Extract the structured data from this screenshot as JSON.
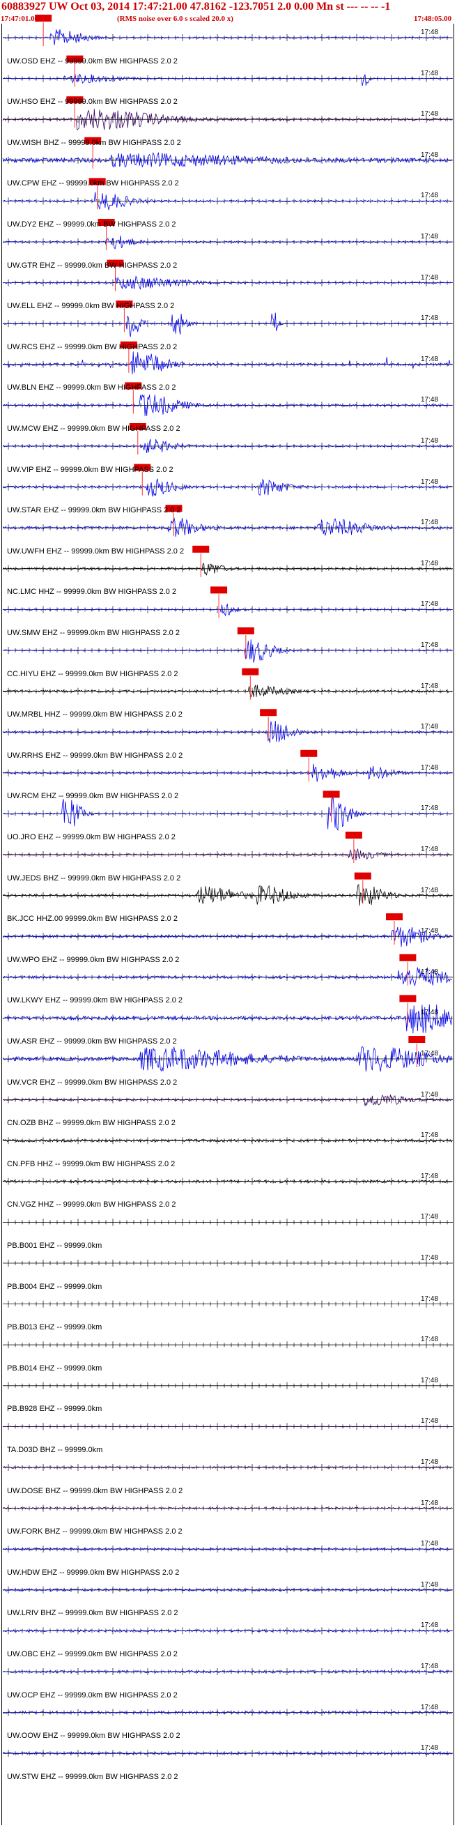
{
  "header": {
    "title": "60883927 UW Oct 03, 2014 17:47:21.00   47.8162 -123.7051  2.0 0.00 Mn st --- -- --   -1",
    "start_time": "17:47:01.00",
    "rms_note": "(RMS noise over 6.0 s scaled 20.0 x)",
    "end_time": "17:48:05.00"
  },
  "time_tick_label": "17:48",
  "colors": {
    "header_text": "#cc0000",
    "pick": "#e00000",
    "pick_line": "#ff3030",
    "trace_blue": "#0000ee",
    "trace_black": "#000000",
    "trace_purple": "#33005a",
    "axis": "#000000"
  },
  "traces": [
    {
      "label": "UW.OSD EHZ -- 99999.0km BW  HIGHPASS  2.0  2",
      "color": "blue",
      "amp": 0.35,
      "pick": 0.09,
      "bursts": [
        [
          0.12,
          0.05,
          2.2
        ]
      ]
    },
    {
      "label": "UW.HSO EHZ -- 99999.0km BW  HIGHPASS  2.0  2",
      "color": "blue",
      "amp": 0.25,
      "pick": 0.16,
      "bursts": [
        [
          0.16,
          0.08,
          1.2
        ],
        [
          0.8,
          0.01,
          2.5
        ]
      ]
    },
    {
      "label": "UW.WISH BHZ -- 99999.0km BW  HIGHPASS  2.0  2",
      "color": "purple",
      "amp": 0.5,
      "pick": 0.16,
      "bursts": [
        [
          0.2,
          0.12,
          3.0
        ]
      ]
    },
    {
      "label": "UW.CPW EHZ -- 99999.0km BW  HIGHPASS  2.0  2",
      "color": "blue",
      "amp": 1.0,
      "pick": 0.2,
      "bursts": [
        [
          0.3,
          0.2,
          1.5
        ]
      ]
    },
    {
      "label": "UW.DY2 EHZ -- 99999.0km BW  HIGHPASS  2.0  2",
      "color": "blue",
      "amp": 0.35,
      "pick": 0.21,
      "bursts": [
        [
          0.22,
          0.05,
          2.5
        ]
      ]
    },
    {
      "label": "UW.GTR EHZ -- 99999.0km BW  HIGHPASS  2.0  2",
      "color": "blue",
      "amp": 0.3,
      "pick": 0.23,
      "bursts": [
        [
          0.24,
          0.04,
          2.0
        ]
      ]
    },
    {
      "label": "UW.ELL EHZ -- 99999.0km BW  HIGHPASS  2.0  2",
      "color": "blue",
      "amp": 0.3,
      "pick": 0.25,
      "bursts": [
        [
          0.28,
          0.1,
          1.8
        ]
      ]
    },
    {
      "label": "UW.RCS EHZ -- 99999.0km BW  HIGHPASS  2.0  2",
      "color": "blue",
      "amp": 0.3,
      "pick": 0.27,
      "bursts": [
        [
          0.28,
          0.02,
          5.0
        ],
        [
          0.38,
          0.02,
          4.5
        ],
        [
          0.6,
          0.01,
          4.0
        ]
      ]
    },
    {
      "label": "UW.BLN EHZ -- 99999.0km BW  HIGHPASS  2.0  2",
      "color": "blue",
      "amp": 0.5,
      "pick": 0.28,
      "bursts": [
        [
          0.3,
          0.05,
          3.5
        ]
      ],
      "spikes": true
    },
    {
      "label": "UW.MCW EHZ -- 99999.0km BW  HIGHPASS  2.0  2",
      "color": "blue",
      "amp": 0.45,
      "pick": 0.29,
      "bursts": [
        [
          0.32,
          0.06,
          3.0
        ]
      ]
    },
    {
      "label": "UW.VIP EHZ -- 99999.0km BW  HIGHPASS  2.0  2",
      "color": "blue",
      "amp": 0.3,
      "pick": 0.3,
      "bursts": [
        [
          0.32,
          0.05,
          2.0
        ]
      ]
    },
    {
      "label": "UW.STAR EHZ -- 99999.0km BW  HIGHPASS  2.0  2",
      "color": "blue",
      "amp": 0.45,
      "pick": 0.31,
      "bursts": [
        [
          0.33,
          0.04,
          2.5
        ],
        [
          0.58,
          0.04,
          2.2
        ]
      ]
    },
    {
      "label": "UW.UWFH EHZ -- 99999.0km BW  HIGHPASS  2.0  2",
      "color": "blue",
      "amp": 0.6,
      "pick": 0.38,
      "bursts": [
        [
          0.38,
          0.04,
          2.8
        ],
        [
          0.72,
          0.07,
          2.4
        ]
      ]
    },
    {
      "label": "NC.LMC HHZ -- 99999.0km BW  HIGHPASS  2.0  2",
      "color": "black",
      "amp": 0.45,
      "pick": 0.44,
      "bursts": [
        [
          0.45,
          0.03,
          1.8
        ]
      ]
    },
    {
      "label": "UW.SMW EHZ -- 99999.0km BW  HIGHPASS  2.0  2",
      "color": "blue",
      "amp": 0.3,
      "pick": 0.48,
      "bursts": [
        [
          0.49,
          0.02,
          1.8
        ]
      ]
    },
    {
      "label": "CC.HIYU EHZ -- 99999.0km BW  HIGHPASS  2.0  2",
      "color": "blue",
      "amp": 0.3,
      "pick": 0.54,
      "bursts": [
        [
          0.55,
          0.04,
          3.5
        ]
      ]
    },
    {
      "label": "UW.MRBL HHZ -- 99999.0km BW  HIGHPASS  2.0  2",
      "color": "black",
      "amp": 0.5,
      "pick": 0.55,
      "bursts": [
        [
          0.56,
          0.05,
          1.6
        ]
      ]
    },
    {
      "label": "UW.RRHS EHZ -- 99999.0km BW  HIGHPASS  2.0  2",
      "color": "blue",
      "amp": 0.35,
      "pick": 0.59,
      "bursts": [
        [
          0.6,
          0.04,
          3.2
        ]
      ]
    },
    {
      "label": "UW.RCM EHZ -- 99999.0km BW  HIGHPASS  2.0  2",
      "color": "blue",
      "amp": 0.35,
      "pick": 0.68,
      "bursts": [
        [
          0.7,
          0.04,
          2.5
        ],
        [
          0.82,
          0.04,
          1.8
        ]
      ]
    },
    {
      "label": "UO.JRO EHZ -- 99999.0km BW  HIGHPASS  2.0  2",
      "color": "blue",
      "amp": 0.3,
      "pick": 0.73,
      "bursts": [
        [
          0.14,
          0.025,
          6.0
        ],
        [
          0.73,
          0.03,
          6.0
        ]
      ]
    },
    {
      "label": "UW.JEDS BHZ -- 99999.0km BW  HIGHPASS  2.0  2",
      "color": "purple",
      "amp": 0.4,
      "pick": 0.78,
      "bursts": [
        [
          0.78,
          0.04,
          1.5
        ]
      ]
    },
    {
      "label": "BK.JCC HHZ.00 99999.0km BW  HIGHPASS  2.0  2",
      "color": "black",
      "amp": 0.5,
      "pick": 0.8,
      "bursts": [
        [
          0.45,
          0.06,
          2.5
        ],
        [
          0.58,
          0.05,
          2.5
        ],
        [
          0.8,
          0.04,
          3.0
        ]
      ]
    },
    {
      "label": "UW.WPO EHZ -- 99999.0km BW  HIGHPASS  2.0  2",
      "color": "blue",
      "amp": 0.6,
      "pick": 0.87,
      "bursts": [
        [
          0.88,
          0.05,
          2.8
        ]
      ]
    },
    {
      "label": "UW.LKWY EHZ -- 99999.0km BW  HIGHPASS  2.0  2",
      "color": "blue",
      "amp": 0.55,
      "pick": 0.9,
      "bursts": [
        [
          0.9,
          0.07,
          3.0
        ]
      ]
    },
    {
      "label": "UW.ASR EHZ -- 99999.0km BW  HIGHPASS  2.0  2",
      "color": "blue",
      "amp": 0.8,
      "pick": 0.9,
      "bursts": [
        [
          0.92,
          0.08,
          4.0
        ]
      ]
    },
    {
      "label": "UW.VCR EHZ -- 99999.0km BW  HIGHPASS  2.0  2",
      "color": "blue",
      "amp": 0.9,
      "pick": 0.92,
      "bursts": [
        [
          0.35,
          0.15,
          3.0
        ],
        [
          0.82,
          0.1,
          3.2
        ]
      ]
    },
    {
      "label": "CN.OZB BHZ -- 99999.0km BW  HIGHPASS  2.0  2",
      "color": "purple",
      "amp": 0.4,
      "bursts": [
        [
          0.82,
          0.06,
          1.8
        ]
      ]
    },
    {
      "label": "CN.PFB HHZ -- 99999.0km BW  HIGHPASS  2.0  2",
      "color": "black",
      "amp": 0.55,
      "bursts": []
    },
    {
      "label": "CN.VGZ HHZ -- 99999.0km BW  HIGHPASS  2.0  2",
      "color": "black",
      "amp": 0.55,
      "bursts": []
    },
    {
      "label": "PB.B001 EHZ -- 99999.0km",
      "color": "black",
      "amp": 0.0,
      "bursts": []
    },
    {
      "label": "PB.B004 EHZ -- 99999.0km",
      "color": "black",
      "amp": 0.0,
      "bursts": []
    },
    {
      "label": "PB.B013 EHZ -- 99999.0km",
      "color": "black",
      "amp": 0.0,
      "bursts": []
    },
    {
      "label": "PB.B014 EHZ -- 99999.0km",
      "color": "black",
      "amp": 0.0,
      "bursts": []
    },
    {
      "label": "PB.B928 EHZ -- 99999.0km",
      "color": "black",
      "amp": 0.0,
      "bursts": []
    },
    {
      "label": "TA.D03D BHZ -- 99999.0km",
      "color": "purple",
      "amp": 0.15,
      "bursts": []
    },
    {
      "label": "UW.DOSE BHZ -- 99999.0km BW  HIGHPASS  2.0  2",
      "color": "purple",
      "amp": 0.4,
      "bursts": []
    },
    {
      "label": "UW.FORK BHZ -- 99999.0km BW  HIGHPASS  2.0  2",
      "color": "purple",
      "amp": 0.4,
      "bursts": []
    },
    {
      "label": "UW.HDW EHZ -- 99999.0km BW  HIGHPASS  2.0  2",
      "color": "blue",
      "amp": 0.4,
      "bursts": []
    },
    {
      "label": "UW.LRIV BHZ -- 99999.0km BW  HIGHPASS  2.0  2",
      "color": "blue",
      "amp": 0.5,
      "bursts": []
    },
    {
      "label": "UW.OBC EHZ -- 99999.0km BW  HIGHPASS  2.0  2",
      "color": "blue",
      "amp": 0.5,
      "bursts": []
    },
    {
      "label": "UW.OCP EHZ -- 99999.0km BW  HIGHPASS  2.0  2",
      "color": "blue",
      "amp": 0.5,
      "bursts": []
    },
    {
      "label": "UW.OOW EHZ -- 99999.0km BW  HIGHPASS  2.0  2",
      "color": "blue",
      "amp": 0.5,
      "bursts": []
    },
    {
      "label": "UW.STW EHZ -- 99999.0km BW  HIGHPASS  2.0  2",
      "color": "blue",
      "amp": 0.45,
      "bursts": []
    }
  ],
  "first_trace_label": "",
  "pick_tag_text": "P"
}
